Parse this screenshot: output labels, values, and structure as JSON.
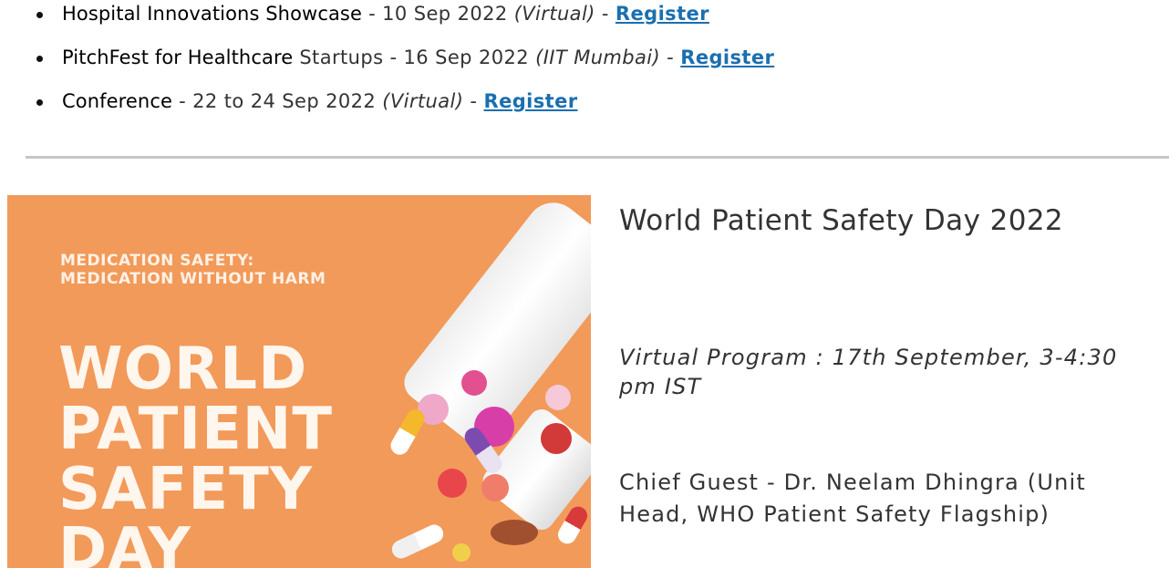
{
  "events": [
    {
      "name": "Hospital Innovations Showcase",
      "date": " - 10 Sep 2022 ",
      "place": "(Virtual)",
      "sep": " - ",
      "link": "Register"
    },
    {
      "name": "PitchFest for Healthcare",
      "date": " Startups - 16 Sep 2022 ",
      "place": "(IIT Mumbai)",
      "sep": " - ",
      "link": "Register"
    },
    {
      "name": "Conference",
      "date": " - 22 to 24 Sep 2022 ",
      "place": "(Virtual)",
      "sep": " - ",
      "link": "Register"
    }
  ],
  "article": {
    "title": "World Patient Safety Day 2022",
    "program": "Virtual Program : 17th September, 3-4:30 pm IST",
    "guest": "Chief Guest - Dr. Neelam Dhingra (Unit Head, WHO Patient Safety Flagship)"
  },
  "poster": {
    "subtitle_line1": "MEDICATION SAFETY:",
    "subtitle_line2": "MEDICATION WITHOUT HARM",
    "headline": [
      "WORLD",
      "PATIENT",
      "SAFETY",
      "DAY"
    ],
    "background_color": "#f29a5a"
  },
  "colors": {
    "link": "#1a6fb0",
    "divider": "#c6c6c6"
  }
}
